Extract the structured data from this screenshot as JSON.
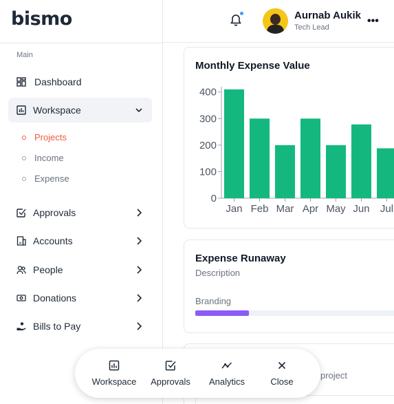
{
  "brand": {
    "name": "bismo",
    "accent": "#ef5a3c"
  },
  "sidebar": {
    "section_label": "Main",
    "items": [
      {
        "label": "Dashboard",
        "icon": "grid-icon"
      },
      {
        "label": "Workspace",
        "icon": "chart-box-icon",
        "expanded": true
      },
      {
        "label": "Approvals",
        "icon": "check-square-icon"
      },
      {
        "label": "Accounts",
        "icon": "building-icon"
      },
      {
        "label": "People",
        "icon": "users-icon"
      },
      {
        "label": "Donations",
        "icon": "banknote-icon"
      },
      {
        "label": "Bills to Pay",
        "icon": "hand-coin-icon"
      }
    ],
    "subitems": [
      {
        "label": "Projects",
        "active": true
      },
      {
        "label": "Income"
      },
      {
        "label": "Expense"
      }
    ]
  },
  "header": {
    "user_name": "Aurnab Aukik",
    "user_role": "Tech Lead",
    "notification_badge_color": "#3b9cff"
  },
  "cards": {
    "expense_chart_title": "Monthly Expense Value",
    "runaway_title": "Expense Runaway",
    "runaway_description": "Description",
    "branding_label": "Branding",
    "branding_progress": 0.26,
    "card3_text": "is project"
  },
  "chart_data": {
    "type": "bar",
    "categories": [
      "Jan",
      "Feb",
      "Mar",
      "Apr",
      "May",
      "Jun",
      "Jul"
    ],
    "values": [
      410,
      300,
      200,
      300,
      200,
      278,
      188
    ],
    "yticks": [
      0,
      100,
      200,
      300,
      400
    ],
    "ylim": [
      0,
      420
    ],
    "bar_color": "#14b87f",
    "grid": false
  },
  "action_bar": [
    {
      "label": "Workspace",
      "icon": "chart-box-icon"
    },
    {
      "label": "Approvals",
      "icon": "check-square-icon"
    },
    {
      "label": "Analytics",
      "icon": "trend-line-icon"
    },
    {
      "label": "Close",
      "icon": "close-icon"
    }
  ]
}
